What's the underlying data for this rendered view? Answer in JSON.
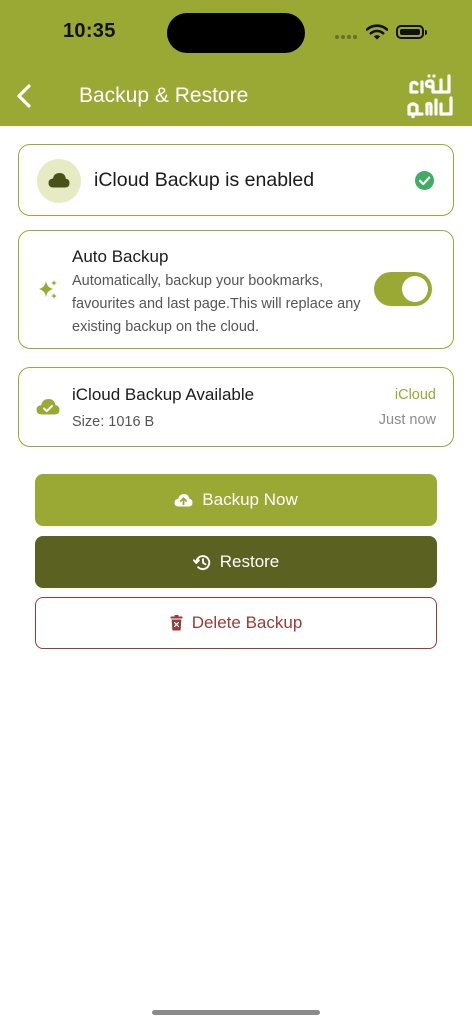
{
  "status_bar": {
    "time": "10:35"
  },
  "header": {
    "title": "Backup & Restore",
    "back_icon": "chevron-left-icon",
    "logo_icon": "quran-calligraphy-logo"
  },
  "backup_status": {
    "title": "iCloud Backup is enabled",
    "icon": "cloud-icon",
    "status_icon": "check-circle-icon"
  },
  "auto_backup": {
    "title": "Auto Backup",
    "description": "Automatically, backup your bookmarks, favourites and last page.This will replace any existing backup on the cloud.",
    "icon": "sparkle-icon",
    "enabled": true
  },
  "available_backup": {
    "title": "iCloud Backup Available",
    "size": "Size: 1016 B",
    "source": "iCloud",
    "time": "Just now",
    "icon": "cloud-check-icon"
  },
  "actions": {
    "backup_now": "Backup Now",
    "restore": "Restore",
    "delete_backup": "Delete Backup"
  },
  "colors": {
    "accent": "#9aa933",
    "dark_accent": "#5b6121",
    "danger": "#9a3b35",
    "check_green": "#3fae63"
  }
}
